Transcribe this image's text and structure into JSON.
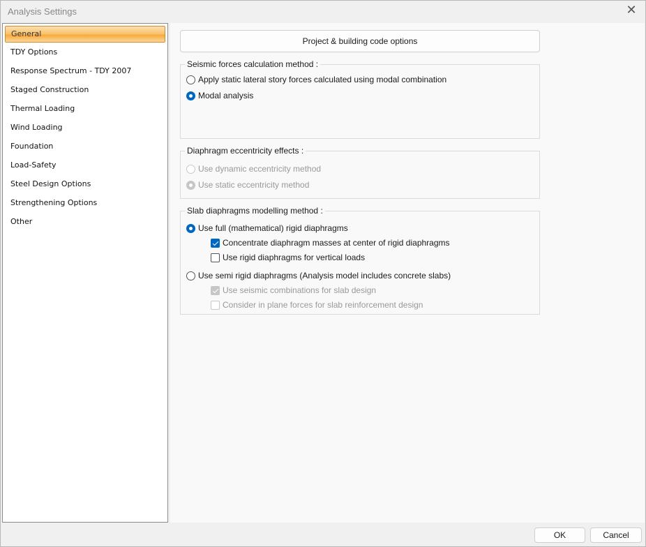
{
  "window": {
    "title": "Analysis Settings",
    "close_icon": "close-icon"
  },
  "sidebar": {
    "items": [
      {
        "label": "General",
        "selected": true
      },
      {
        "label": "TDY Options"
      },
      {
        "label": "Response Spectrum - TDY 2007"
      },
      {
        "label": "Staged Construction"
      },
      {
        "label": "Thermal Loading"
      },
      {
        "label": "Wind Loading"
      },
      {
        "label": "Foundation"
      },
      {
        "label": "Load-Safety"
      },
      {
        "label": "Steel Design Options"
      },
      {
        "label": "Strengthening Options"
      },
      {
        "label": "Other"
      }
    ]
  },
  "main": {
    "project_button": "Project & building code options",
    "seismic": {
      "title": "Seismic forces calculation method :",
      "opt1": "Apply static lateral story forces calculated using modal combination",
      "opt2": "Modal analysis"
    },
    "eccentricity": {
      "title": "Diaphragm eccentricity effects :",
      "opt1": "Use dynamic eccentricity method",
      "opt2": "Use static eccentricity method"
    },
    "slab": {
      "title": "Slab diaphragms modelling method :",
      "opt1": "Use full (mathematical) rigid diaphragms",
      "chk1": "Concentrate diaphragm masses at center of rigid diaphragms",
      "chk2": "Use rigid diaphragms for vertical loads",
      "opt2": "Use semi rigid diaphragms (Analysis model includes concrete slabs)",
      "chk3": "Use seismic combinations for slab design",
      "chk4": "Consider in plane forces for slab reinforcement design"
    }
  },
  "footer": {
    "ok": "OK",
    "cancel": "Cancel"
  },
  "colors": {
    "accent": "#0067c0",
    "selection": "#f9c06a"
  }
}
